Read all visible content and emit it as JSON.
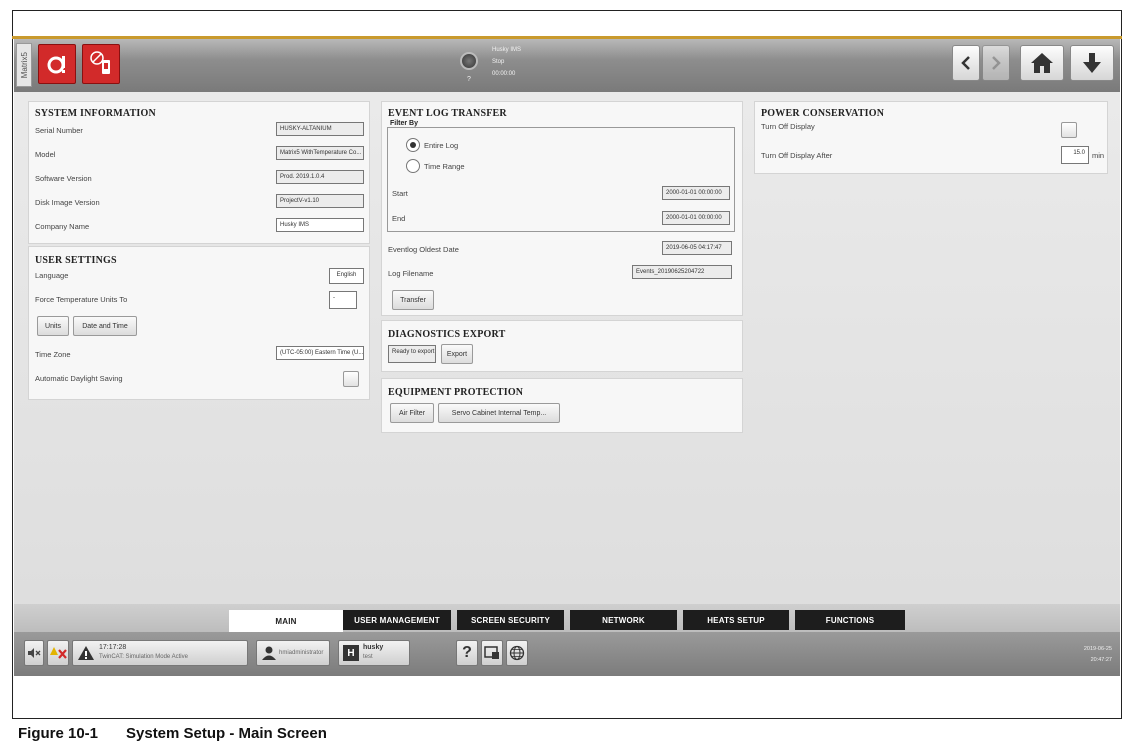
{
  "app": {
    "vertical_tab": "Matrix5"
  },
  "header": {
    "status_line1": "Husky IMS",
    "status_line2": "Stop",
    "status_line3": "00:00:00",
    "status_q": "?",
    "icons": [
      "alarm-icon",
      "no-heat-icon",
      "back-icon",
      "forward-icon",
      "home-icon",
      "download-icon"
    ]
  },
  "system_information": {
    "title": "SYSTEM INFORMATION",
    "rows": [
      {
        "label": "Serial Number",
        "value": "HUSKY-ALTANIUM"
      },
      {
        "label": "Model",
        "value": "Matrix5 WithTemperature Co..."
      },
      {
        "label": "Software Version",
        "value": "Prod. 2019.1.0.4"
      },
      {
        "label": "Disk Image Version",
        "value": "ProjectV-v1.10"
      },
      {
        "label": "Company Name",
        "value": "Husky IMS"
      }
    ]
  },
  "user_settings": {
    "title": "USER SETTINGS",
    "language_label": "Language",
    "language_value": "English",
    "force_units_label": "Force Temperature Units To",
    "force_units_value": "-",
    "units_button": "Units",
    "date_time_button": "Date and Time",
    "timezone_label": "Time Zone",
    "timezone_value": "(UTC-05:00) Eastern Time (U...",
    "dst_label": "Automatic Daylight Saving",
    "dst_checked": false
  },
  "event_log": {
    "title": "EVENT LOG TRANSFER",
    "filter_legend": "Filter By",
    "option_entire": "Entire Log",
    "option_range": "Time Range",
    "selected": "Entire Log",
    "start_label": "Start",
    "start_value": "2000-01-01 00:00:00",
    "end_label": "End",
    "end_value": "2000-01-01 00:00:00",
    "oldest_label": "Eventlog Oldest Date",
    "oldest_value": "2019-06-05 04:17:47",
    "filename_label": "Log Filename",
    "filename_value": "Events_20190625204722",
    "transfer_button": "Transfer"
  },
  "diagnostics": {
    "title": "DIAGNOSTICS EXPORT",
    "status": "Ready to export",
    "export_button": "Export"
  },
  "equipment": {
    "title": "EQUIPMENT PROTECTION",
    "air_filter_button": "Air Filter",
    "servo_button": "Servo Cabinet Internal Temp..."
  },
  "power": {
    "title": "POWER CONSERVATION",
    "turn_off_label": "Turn Off Display",
    "turn_off_checked": false,
    "after_label": "Turn Off Display After",
    "after_value": "15.0",
    "after_unit": "min"
  },
  "tabs": [
    {
      "label": "MAIN",
      "active": true
    },
    {
      "label": "USER MANAGEMENT",
      "active": false
    },
    {
      "label": "SCREEN SECURITY",
      "active": false
    },
    {
      "label": "NETWORK",
      "active": false
    },
    {
      "label": "HEATS SETUP",
      "active": false
    },
    {
      "label": "FUNCTIONS",
      "active": false
    }
  ],
  "statusbar": {
    "alarm_time": "17:17:28",
    "alarm_text": "TwinCAT: Simulation Mode Active",
    "user": "hmiadministrator",
    "brand": "husky",
    "brand_sub": "test",
    "help": "?",
    "date": "2019-06-25",
    "time": "20:47:27"
  },
  "caption": {
    "number": "Figure 10-1",
    "text": "System Setup - Main Screen"
  },
  "colors": {
    "accent_gold": "#c99a2e",
    "alarm_red": "#d22a2a",
    "tab_dark": "#1d1d1d"
  }
}
